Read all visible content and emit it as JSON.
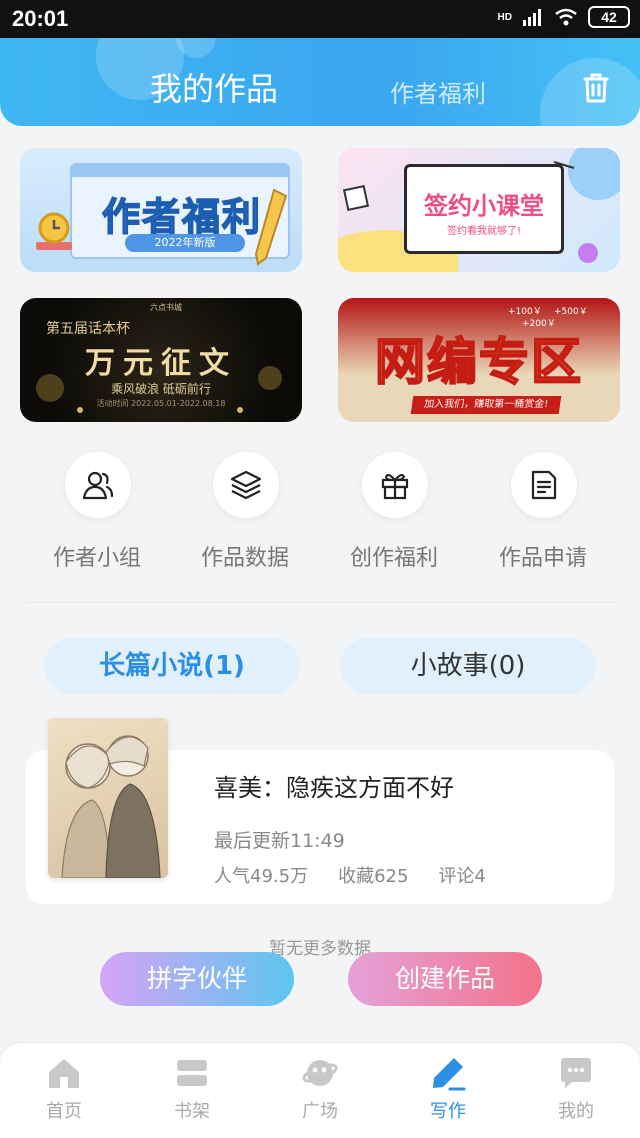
{
  "status_bar": {
    "time": "20:01",
    "network": "HD",
    "battery": "42"
  },
  "header": {
    "active_tab": "我的作品",
    "tab": "作者福利"
  },
  "banners": {
    "b1": {
      "title": "作者福利",
      "sub": "2022年新版"
    },
    "b2": {
      "title": "签约小课堂",
      "sub": "签约看我就够了!"
    },
    "b3": {
      "small": "六点书城",
      "cup": "第五届话本杯",
      "title": "万元征文",
      "sub": "乘风破浪 砥砺前行",
      "date": "活动时间 2022.05.01-2022.08.18"
    },
    "b4": {
      "title": "网编专区",
      "strip": "加入我们，赚取第一桶赏金!",
      "m1": "+100￥",
      "m2": "+200￥",
      "m3": "+500￥"
    }
  },
  "shortcuts": [
    {
      "label": "作者小组",
      "icon": "users-icon"
    },
    {
      "label": "作品数据",
      "icon": "layers-icon"
    },
    {
      "label": "创作福利",
      "icon": "gift-icon"
    },
    {
      "label": "作品申请",
      "icon": "document-icon"
    }
  ],
  "works_tabs": {
    "long": "长篇小说(1)",
    "short": "小故事(0)"
  },
  "work": {
    "title": "喜美：隐疾这方面不好",
    "updated": "最后更新11:49",
    "popularity": "人气49.5万",
    "favorites": "收藏625",
    "comments": "评论4"
  },
  "no_more": "暂无更多数据",
  "buttons": {
    "partner": "拼字伙伴",
    "create": "创建作品"
  },
  "bottom_nav": [
    {
      "label": "首页",
      "icon": "home-icon",
      "active": false
    },
    {
      "label": "书架",
      "icon": "bookshelf-icon",
      "active": false
    },
    {
      "label": "广场",
      "icon": "planet-icon",
      "active": false
    },
    {
      "label": "写作",
      "icon": "pen-icon",
      "active": true
    },
    {
      "label": "我的",
      "icon": "chat-icon",
      "active": false
    }
  ],
  "colors": {
    "accent": "#2b8fe6",
    "header": "#3aa6ef",
    "create": "#f47289"
  }
}
